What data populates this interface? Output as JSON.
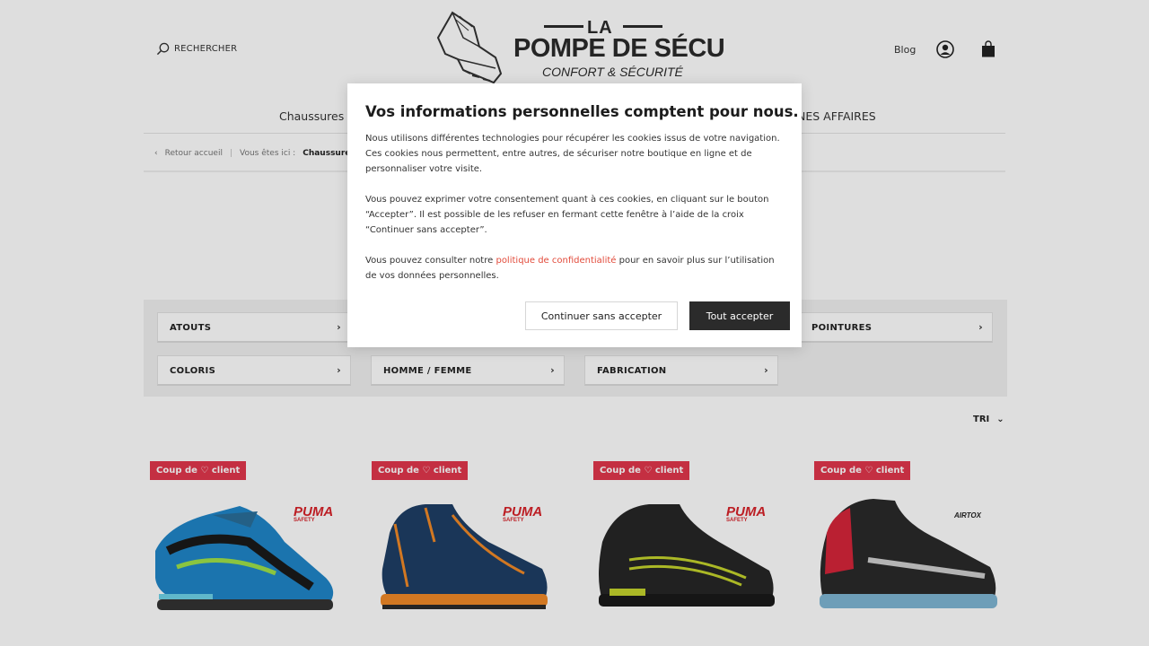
{
  "header": {
    "search_label": "RECHERCHER",
    "logo": {
      "top": "LA",
      "main": "POMPE DE SÉCU",
      "sub": "CONFORT & SÉCURITÉ"
    },
    "blog_label": "Blog"
  },
  "nav": {
    "items": [
      "Chaussures d",
      "NES AFFAIRES"
    ]
  },
  "breadcrumb": {
    "back": "Retour accueil",
    "you_are_here": "Vous êtes ici :",
    "current": "Chaussures d"
  },
  "filters": {
    "items": [
      "ATOUTS",
      "POINTURES",
      "COLORIS",
      "HOMME / FEMME",
      "FABRICATION"
    ]
  },
  "sort": {
    "label": "TRI"
  },
  "products": [
    {
      "badge": "Coup de ♡ client",
      "brand": "PUMA",
      "brand_sub": "SAFETY"
    },
    {
      "badge": "Coup de ♡ client",
      "brand": "PUMA",
      "brand_sub": "SAFETY"
    },
    {
      "badge": "Coup de ♡ client",
      "brand": "PUMA",
      "brand_sub": "SAFETY"
    },
    {
      "badge": "Coup de ♡ client",
      "brand": "AIRTOX",
      "brand_sub": ""
    }
  ],
  "cookie_modal": {
    "title": "Vos informations personnelles comptent pour nous.",
    "paragraph1": "Nous utilisons différentes technologies pour récupérer les cookies issus de votre navigation. Ces cookies nous permettent, entre autres, de sécuriser notre boutique en ligne et de personnaliser votre visite.",
    "paragraph2": "Vous pouvez exprimer votre consentement quant à ces cookies, en cliquant sur le bouton “Accepter”. Il est possible de les refuser en fermant cette fenêtre à l’aide de la croix “Continuer sans accepter”.",
    "paragraph3_before": "Vous pouvez consulter notre ",
    "paragraph3_link": "politique de confidentialité",
    "paragraph3_after": " pour en savoir plus sur l’utilisation de vos données personnelles.",
    "refuse_label": "Continuer sans accepter",
    "accept_label": "Tout accepter"
  },
  "colors": {
    "badge": "#e2364c",
    "accept_button": "#2b2b2b",
    "link": "#e24b3b",
    "filters_bg": "#f1f1f1"
  },
  "icons": [
    "search-icon",
    "user-icon",
    "bag-icon",
    "chevron-left-icon",
    "chevron-right-icon",
    "chevron-down-icon",
    "heart-icon"
  ]
}
